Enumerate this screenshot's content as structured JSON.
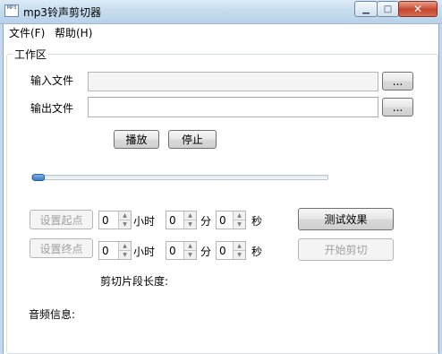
{
  "window": {
    "title": "mp3铃声剪切器",
    "icon_text": "MP3",
    "minimize_icon": "minimize-icon",
    "maximize_icon": "maximize-icon",
    "close_icon": "close-icon"
  },
  "menu": {
    "file": "文件(F)",
    "help": "帮助(H)"
  },
  "workspace": {
    "group_label": "工作区",
    "input_label": "输入文件",
    "input_value": "",
    "output_label": "输出文件",
    "output_value": "",
    "browse_label": "...",
    "play_label": "播放",
    "stop_label": "停止",
    "slider_position": 0
  },
  "start": {
    "button_label": "设置起点",
    "hours": "0",
    "minutes": "0",
    "seconds": "0"
  },
  "end": {
    "button_label": "设置终点",
    "hours": "0",
    "minutes": "0",
    "seconds": "0"
  },
  "units": {
    "hour": "小时",
    "minute": "分",
    "second": "秒"
  },
  "actions": {
    "test_label": "测试效果",
    "cut_label": "开始剪切"
  },
  "info": {
    "segment_length_label": "剪切片段长度:",
    "audio_info_label": "音频信息:"
  }
}
